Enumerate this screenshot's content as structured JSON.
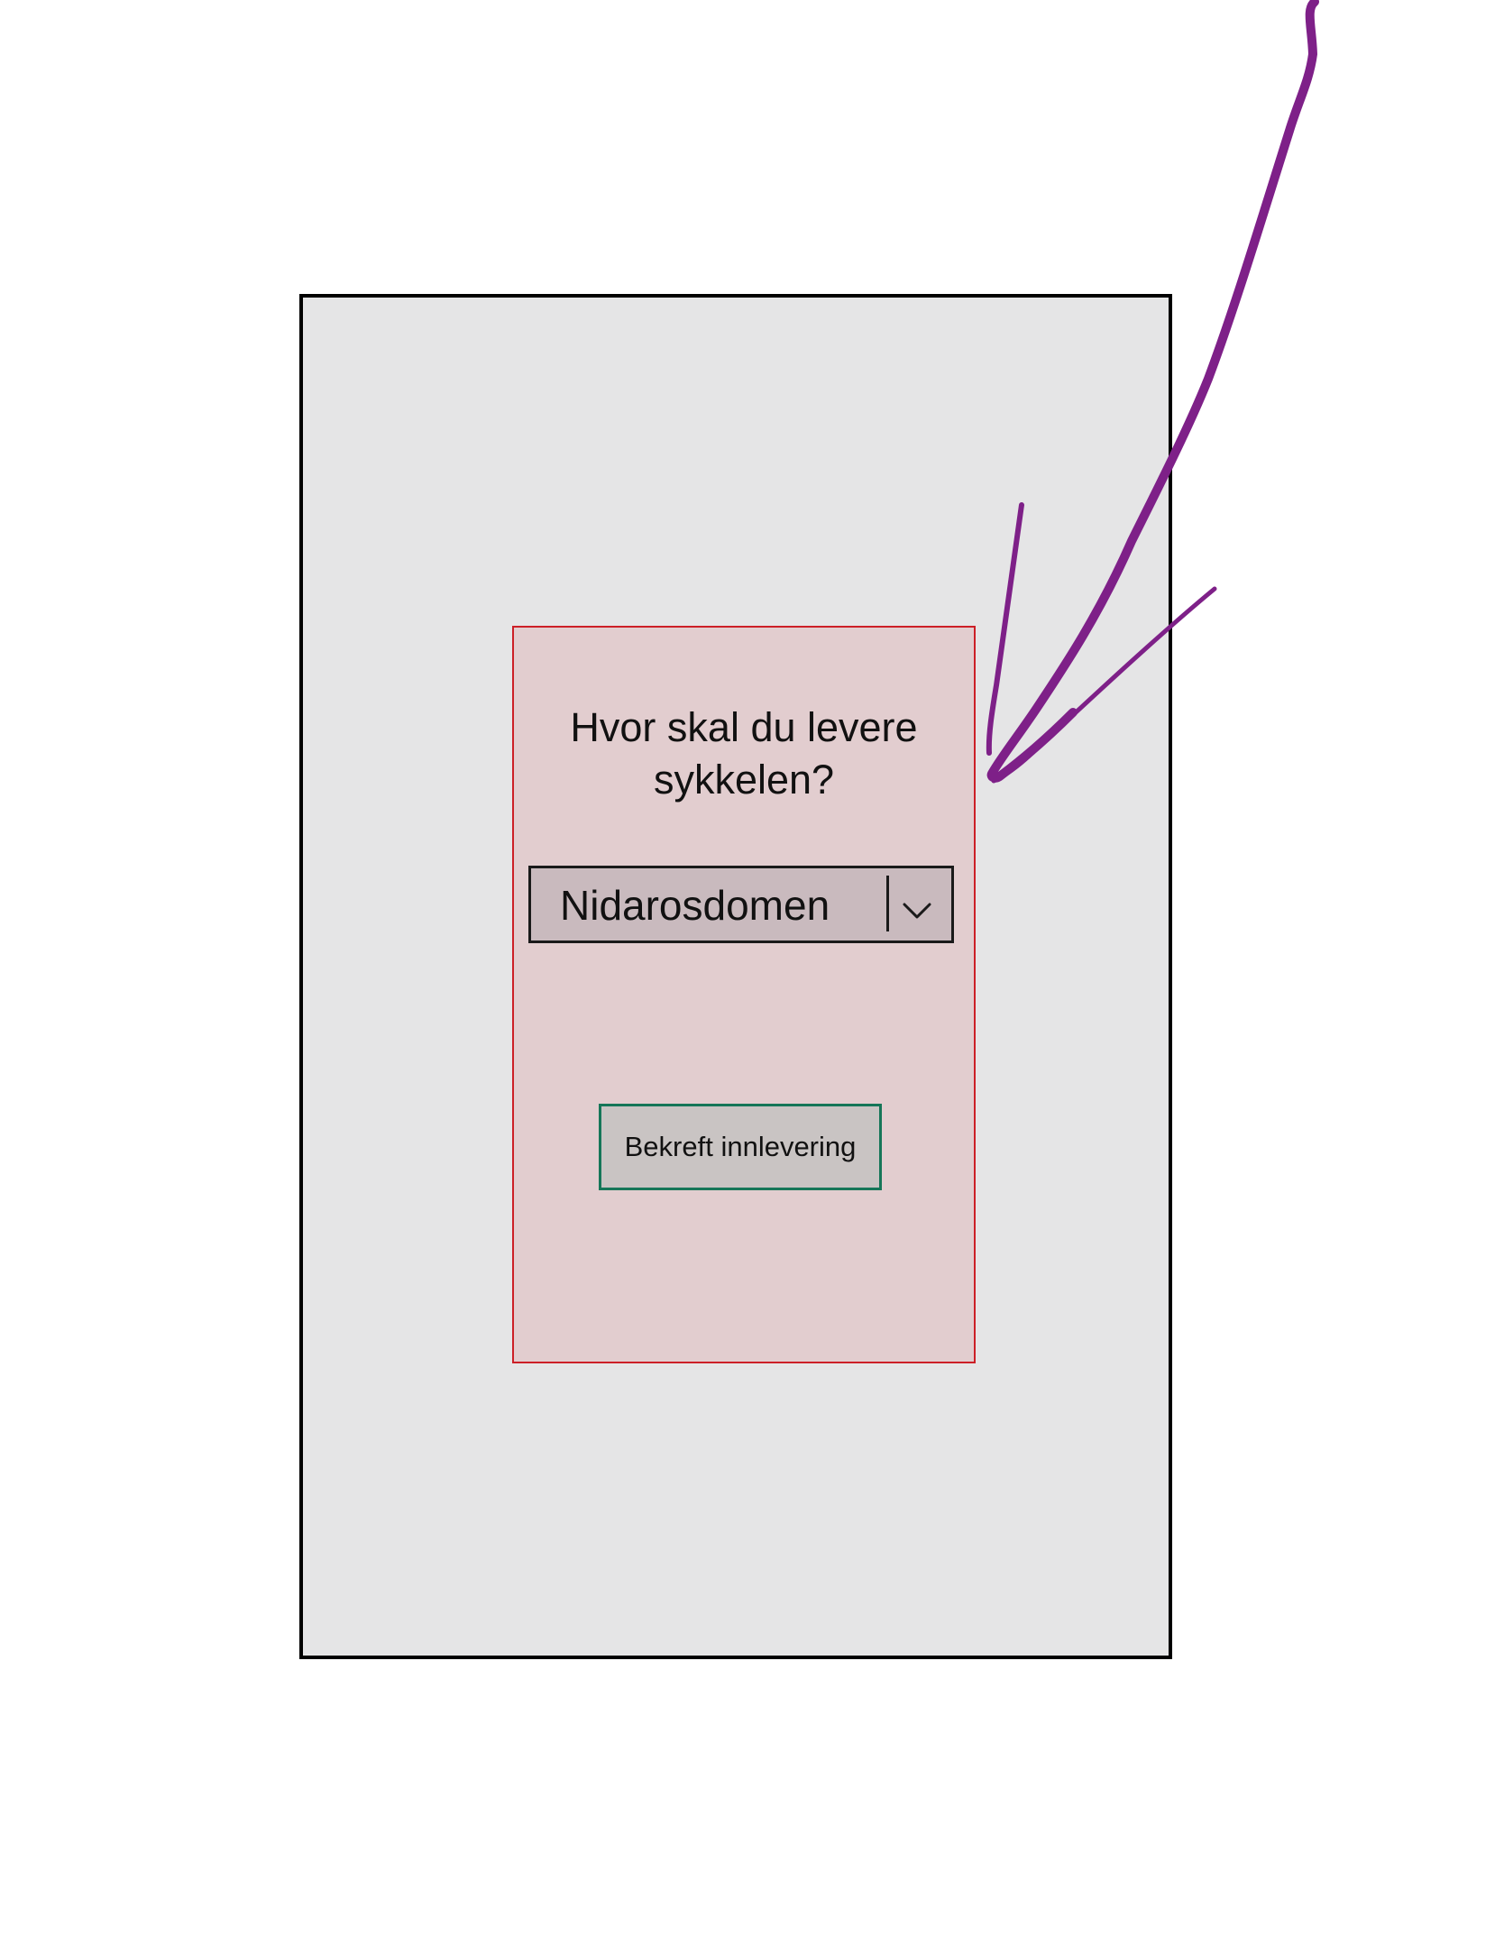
{
  "dialog": {
    "title_line1": "Hvor skal du levere",
    "title_line2": "sykkelen?",
    "location_select": {
      "selected_value": "Nidarosdomen"
    },
    "confirm_button_label": "Bekreft innlevering"
  },
  "colors": {
    "frame_background": "#e5e5e6",
    "dialog_background": "#e2cdcf",
    "dialog_border": "#cc1f27",
    "select_background": "#c9babe",
    "button_background": "#c9c4c3",
    "button_border": "#157658",
    "annotation_arrow": "#7e2088"
  },
  "icons": {
    "select_icon": "chevron-down-icon",
    "annotation": "annotation-arrow-icon"
  }
}
